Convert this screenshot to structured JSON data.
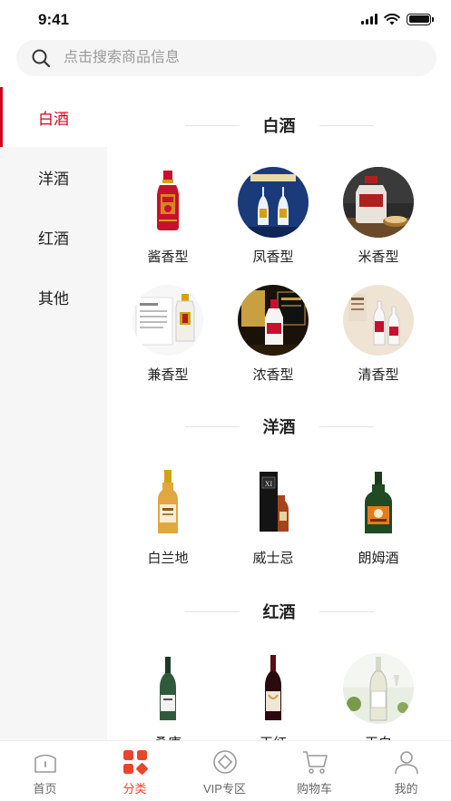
{
  "status_bar": {
    "time": "9:41"
  },
  "search": {
    "placeholder": "点击搜索商品信息",
    "value": ""
  },
  "sidebar": {
    "items": [
      {
        "label": "白酒",
        "active": true
      },
      {
        "label": "洋酒",
        "active": false
      },
      {
        "label": "红酒",
        "active": false
      },
      {
        "label": "其他",
        "active": false
      }
    ]
  },
  "sections": [
    {
      "title": "白酒",
      "products": [
        {
          "label": "酱香型",
          "icon": "red-baijiu-bottle-icon"
        },
        {
          "label": "凤香型",
          "icon": "fengxiang-bottles-icon"
        },
        {
          "label": "米香型",
          "icon": "mixiang-jar-icon"
        },
        {
          "label": "兼香型",
          "icon": "jianxiang-box-icon"
        },
        {
          "label": "浓香型",
          "icon": "nongxiang-bottle-icon"
        },
        {
          "label": "清香型",
          "icon": "qingxiang-bottles-icon"
        }
      ]
    },
    {
      "title": "洋酒",
      "products": [
        {
          "label": "白兰地",
          "icon": "brandy-bottle-icon"
        },
        {
          "label": "威士忌",
          "icon": "whisky-box-icon"
        },
        {
          "label": "朗姆酒",
          "icon": "rum-bottle-icon"
        }
      ]
    },
    {
      "title": "红酒",
      "products": [
        {
          "label": "桑康",
          "icon": "wine-bottle-green-icon"
        },
        {
          "label": "干红",
          "icon": "wine-bottle-red-icon"
        },
        {
          "label": "干白",
          "icon": "wine-bottle-white-icon"
        }
      ]
    }
  ],
  "tabbar": {
    "items": [
      {
        "label": "首页",
        "icon": "home-icon",
        "active": false
      },
      {
        "label": "分类",
        "icon": "category-icon",
        "active": true
      },
      {
        "label": "VIP专区",
        "icon": "vip-icon",
        "active": false
      },
      {
        "label": "购物车",
        "icon": "cart-icon",
        "active": false
      },
      {
        "label": "我的",
        "icon": "profile-icon",
        "active": false
      }
    ]
  },
  "colors": {
    "accent": "#d0021b",
    "tab_active": "#e8452c",
    "sidebar_bg": "#f6f6f6"
  }
}
